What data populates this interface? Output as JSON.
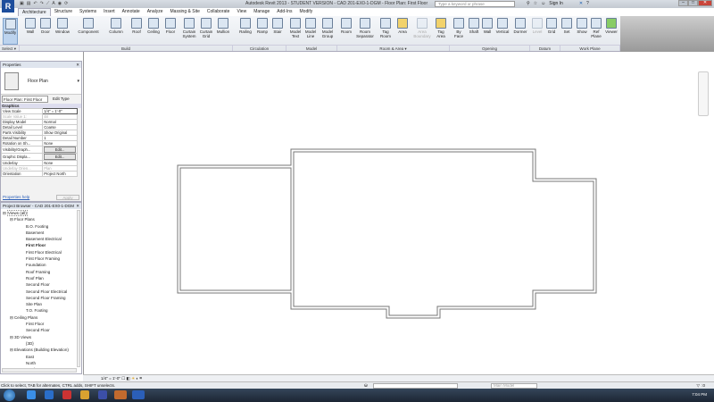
{
  "titlebar": {
    "app_logo": "R",
    "title": "Autodesk Revit 2013 - STUDENT VERSION - CAD 201-EX0-1-DGM - Floor Plan: First Floor",
    "search_placeholder": "Type a keyword or phrase",
    "sign_in": "Sign In",
    "help": "?"
  },
  "tabs": [
    "Architecture",
    "Structure",
    "Systems",
    "Insert",
    "Annotate",
    "Analyze",
    "Massing & Site",
    "Collaborate",
    "View",
    "Manage",
    "Add-Ins",
    "Modify"
  ],
  "tools": {
    "modify": "Modify",
    "wall": "Wall",
    "door": "Door",
    "window": "Window",
    "component": "Component",
    "column": "Column",
    "roof": "Roof",
    "ceiling": "Ceiling",
    "floor": "Floor",
    "curtain_system": "Curtain System",
    "curtain_grid": "Curtain Grid",
    "mullion": "Mullion",
    "railing": "Railing",
    "ramp": "Ramp",
    "stair": "Stair",
    "model_text": "Model Text",
    "model_line": "Model Line",
    "model_group": "Model Group",
    "room": "Room",
    "room_separator": "Room Separator",
    "tag_room": "Tag Room",
    "area": "Area",
    "area_boundary": "Area Boundary",
    "tag_area": "Tag Area",
    "by_face": "By Face",
    "shaft": "Shaft",
    "wall_opening": "Wall",
    "vertical": "Vertical",
    "dormer": "Dormer",
    "level": "Level",
    "grid": "Grid",
    "set": "Set",
    "show": "Show",
    "ref_plane": "Ref Plane",
    "viewer": "Viewer"
  },
  "panels": {
    "select": "Select ▾",
    "build": "Build",
    "circulation": "Circulation",
    "model": "Model",
    "room_area": "Room & Area ▾",
    "opening": "Opening",
    "datum": "Datum",
    "work_plane": "Work Plane"
  },
  "properties": {
    "title": "Properties",
    "type_name": "Floor Plan",
    "instance_selector": "Floor Plan: First Floor",
    "edit_type": "Edit Type",
    "group": "Graphics",
    "rows": [
      [
        "View Scale",
        "1/4\" = 1'-0\""
      ],
      [
        "Scale Value    1:",
        "48"
      ],
      [
        "Display Model",
        "Normal"
      ],
      [
        "Detail Level",
        "Coarse"
      ],
      [
        "Parts Visibility",
        "Show Original"
      ],
      [
        "Detail Number",
        "1"
      ],
      [
        "Rotation on Sh...",
        "None"
      ],
      [
        "Visibility/Graph...",
        "Edit..."
      ],
      [
        "Graphic Displa...",
        "Edit..."
      ],
      [
        "Underlay",
        "None"
      ],
      [
        "Underlay Orien...",
        "Plan"
      ],
      [
        "Orientation",
        "Project North"
      ]
    ],
    "help_link": "Properties help",
    "apply": "Apply"
  },
  "browser": {
    "title": "Project Browser - CAD 201-EX0-1-DGM",
    "root": "Views (all)",
    "groups": [
      {
        "name": "Floor Plans",
        "items": [
          "B.O. Footing",
          "Basement",
          "Basement Electrical",
          "First Floor",
          "First Floor Electrical",
          "First Floor Framing",
          "Foundation",
          "Roof Framing",
          "Roof Plan",
          "Second Floor",
          "Second Floor Electrical",
          "Second Floor Framing",
          "Site Plan",
          "T.O. Footing"
        ]
      },
      {
        "name": "Ceiling Plans",
        "items": [
          "First Floor",
          "Second Floor"
        ]
      },
      {
        "name": "3D Views",
        "items": [
          "{3D}"
        ]
      },
      {
        "name": "Elevations (Building Elevation)",
        "items": [
          "East",
          "North",
          "South"
        ]
      }
    ]
  },
  "viewbar": {
    "scale": "1/4\" = 1'-0\""
  },
  "status": {
    "message": "Click to select, TAB for alternates, CTRL adds, SHIFT unselects.",
    "workset": "Main Model",
    "filter_count": ":0"
  },
  "taskbar": {
    "clock": "7:04 PM"
  }
}
